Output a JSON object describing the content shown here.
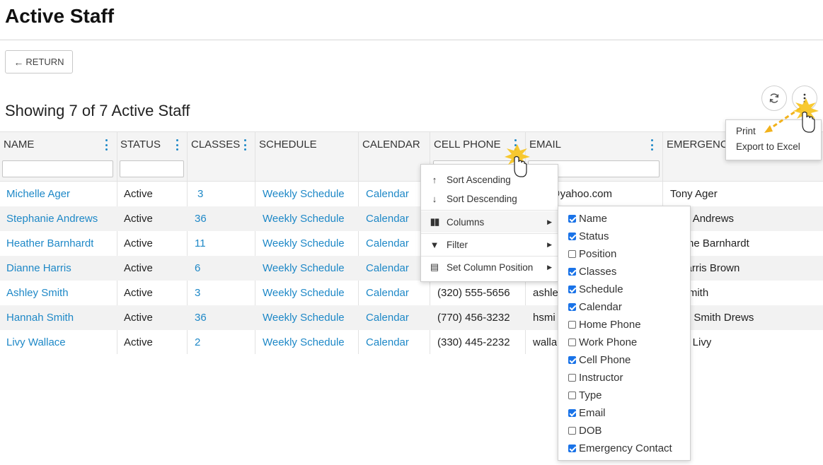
{
  "page": {
    "title": "Active Staff",
    "return_label": "RETURN",
    "showing": "Showing 7 of 7 Active Staff"
  },
  "toolbar": {
    "refresh_icon": "refresh-icon",
    "more_icon": "more-vertical-icon"
  },
  "export_menu": {
    "print": "Print",
    "export_excel": "Export to Excel"
  },
  "table": {
    "headers": [
      "NAME",
      "STATUS",
      "CLASSES",
      "SCHEDULE",
      "CALENDAR",
      "CELL PHONE",
      "EMAIL",
      "EMERGENC"
    ],
    "rows": [
      {
        "name": "Michelle Ager",
        "status": "Active",
        "classes": "3",
        "schedule": "Weekly Schedule",
        "calendar": "Calendar",
        "phone": "",
        "email": "elle@yahoo.com",
        "emergency": "Tony Ager"
      },
      {
        "name": "Stephanie Andrews",
        "status": "Active",
        "classes": "36",
        "schedule": "Weekly Schedule",
        "calendar": "Calendar",
        "phone": "",
        "email": "",
        "emergency": "hael Andrews"
      },
      {
        "name": "Heather Barnhardt",
        "status": "Active",
        "classes": "11",
        "schedule": "Weekly Schedule",
        "calendar": "Calendar",
        "phone": "",
        "email": "",
        "emergency": "herine Barnhardt"
      },
      {
        "name": "Dianne Harris",
        "status": "Active",
        "classes": "6",
        "schedule": "Weekly Schedule",
        "calendar": "Calendar",
        "phone": "",
        "email": "",
        "emergency": "y Harris Brown"
      },
      {
        "name": "Ashley Smith",
        "status": "Active",
        "classes": "3",
        "schedule": "Weekly Schedule",
        "calendar": "Calendar",
        "phone": "(320) 555-5656",
        "email": "ashle",
        "emergency": "in Smith"
      },
      {
        "name": "Hannah Smith",
        "status": "Active",
        "classes": "36",
        "schedule": "Weekly Schedule",
        "calendar": "Calendar",
        "phone": "(770) 456-3232",
        "email": "hsmi",
        "emergency": "man Smith Drews"
      },
      {
        "name": "Livy Wallace",
        "status": "Active",
        "classes": "2",
        "schedule": "Weekly Schedule",
        "calendar": "Calendar",
        "phone": "(330) 445-2232",
        "email": "walla",
        "emergency": "lace Livy"
      }
    ]
  },
  "column_menu": {
    "sort_asc": "Sort Ascending",
    "sort_desc": "Sort Descending",
    "columns": "Columns",
    "filter": "Filter",
    "set_position": "Set Column Position"
  },
  "columns_submenu": [
    {
      "label": "Name",
      "checked": true
    },
    {
      "label": "Status",
      "checked": true
    },
    {
      "label": "Position",
      "checked": false
    },
    {
      "label": "Classes",
      "checked": true
    },
    {
      "label": "Schedule",
      "checked": true
    },
    {
      "label": "Calendar",
      "checked": true
    },
    {
      "label": "Home Phone",
      "checked": false
    },
    {
      "label": "Work Phone",
      "checked": false
    },
    {
      "label": "Cell Phone",
      "checked": true
    },
    {
      "label": "Instructor",
      "checked": false
    },
    {
      "label": "Type",
      "checked": false
    },
    {
      "label": "Email",
      "checked": true
    },
    {
      "label": "DOB",
      "checked": false
    },
    {
      "label": "Emergency Contact",
      "checked": true
    }
  ],
  "colors": {
    "link": "#1e88c7",
    "checkbox": "#1a73e8",
    "annotation": "#f2b21b"
  }
}
